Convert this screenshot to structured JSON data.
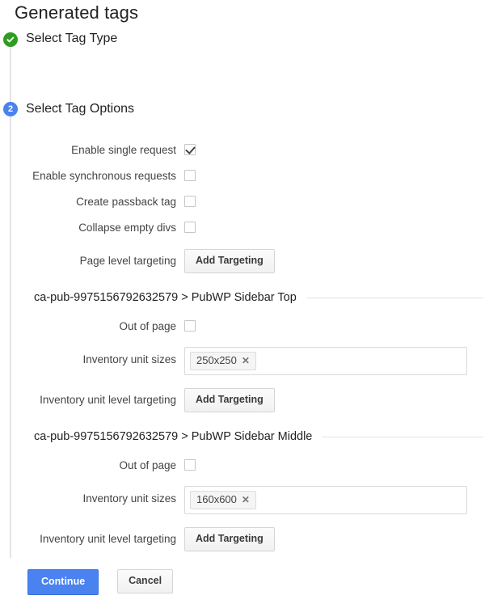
{
  "page": {
    "title": "Generated tags"
  },
  "stepper": {
    "steps": [
      {
        "badge_icon": "check-icon",
        "number": "",
        "label": "Select Tag Type",
        "state": "completed"
      },
      {
        "badge_icon": "",
        "number": "2",
        "label": "Select Tag Options",
        "state": "current"
      }
    ]
  },
  "tag_options": {
    "rows": [
      {
        "label": "Enable single request",
        "type": "checkbox",
        "checked": true
      },
      {
        "label": "Enable synchronous requests",
        "type": "checkbox",
        "checked": false
      },
      {
        "label": "Create passback tag",
        "type": "checkbox",
        "checked": false
      },
      {
        "label": "Collapse empty divs",
        "type": "checkbox",
        "checked": false
      },
      {
        "label": "Page level targeting",
        "type": "button",
        "button_label": "Add Targeting"
      }
    ]
  },
  "sections": [
    {
      "heading": "ca-pub-9975156792632579 > PubWP Sidebar Top",
      "out_of_page_label": "Out of page",
      "out_of_page_checked": false,
      "sizes_label": "Inventory unit sizes",
      "sizes": [
        {
          "value": "250x250",
          "remove_icon": "close-icon"
        }
      ],
      "targeting_label": "Inventory unit level targeting",
      "targeting_button_label": "Add Targeting"
    },
    {
      "heading": "ca-pub-9975156792632579 > PubWP Sidebar Middle",
      "out_of_page_label": "Out of page",
      "out_of_page_checked": false,
      "sizes_label": "Inventory unit sizes",
      "sizes": [
        {
          "value": "160x600",
          "remove_icon": "close-icon"
        }
      ],
      "targeting_label": "Inventory unit level targeting",
      "targeting_button_label": "Add Targeting"
    }
  ],
  "footer": {
    "continue_label": "Continue",
    "cancel_label": "Cancel"
  },
  "colors": {
    "primary_blue": "#4a82f0",
    "success_green": "#2e9c20",
    "rail_gray": "#e4e4e4",
    "divider_gray": "#e2e2e2"
  }
}
